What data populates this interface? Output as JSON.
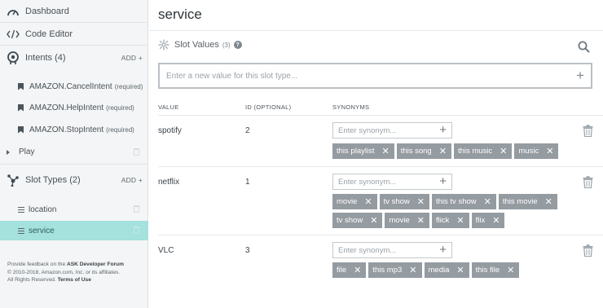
{
  "sidebar": {
    "dashboard": "Dashboard",
    "code_editor": "Code Editor",
    "intents": {
      "label": "Intents (4)",
      "add": "ADD"
    },
    "intent_items": [
      {
        "label": "AMAZON.CancelIntent",
        "tag": "(required)"
      },
      {
        "label": "AMAZON.HelpIntent",
        "tag": "(required)"
      },
      {
        "label": "AMAZON.StopIntent",
        "tag": "(required)"
      }
    ],
    "play": "Play",
    "slot_types": {
      "label": "Slot Types (2)",
      "add": "ADD"
    },
    "slot_items": [
      "location",
      "service"
    ],
    "footer": {
      "line1_pre": "Provide feedback on the",
      "line1_link": "ASK Developer Forum",
      "line2": "© 2010-2018, Amazon.com, Inc. or its affiliates.",
      "line3_pre": "All Rights Reserved.",
      "line3_link": "Terms of Use"
    }
  },
  "main": {
    "title": "service",
    "slot_values_label": "Slot Values",
    "slot_values_count": "(3)",
    "help_glyph": "?",
    "new_value_placeholder": "Enter a new value for this slot type...",
    "columns": {
      "value": "VALUE",
      "id": "ID (OPTIONAL)",
      "synonyms": "SYNONYMS"
    },
    "synonym_placeholder": "Enter synonym...",
    "rows": [
      {
        "value": "spotify",
        "id": "2",
        "synonyms": [
          "this playlist",
          "this song",
          "this music",
          "music"
        ]
      },
      {
        "value": "netflix",
        "id": "1",
        "synonyms": [
          "movie",
          "tv show",
          "this tv show",
          "this movie",
          "tv show",
          "movie",
          "flick",
          "flix"
        ]
      },
      {
        "value": "VLC",
        "id": "3",
        "synonyms": [
          "file",
          "this mp3",
          "media",
          "this file"
        ]
      }
    ]
  },
  "icons": {
    "plus": "+",
    "close": "✕"
  },
  "colors": {
    "active_item": "#a5e1dd",
    "tag_bg": "#949ba1"
  }
}
